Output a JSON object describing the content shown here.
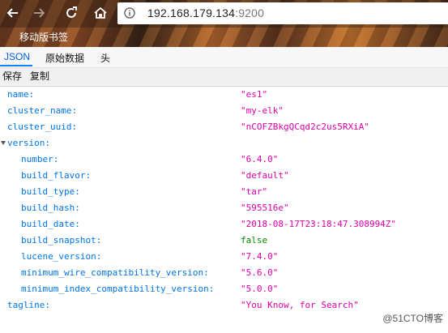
{
  "browser": {
    "url_host": "192.168.179.134",
    "url_port": ":9200",
    "bookmarks_label": "移动版书签"
  },
  "tabs": [
    {
      "label": "JSON",
      "active": true
    },
    {
      "label": "原始数据",
      "active": false
    },
    {
      "label": "头",
      "active": false
    }
  ],
  "toolbar": {
    "save_label": "保存",
    "copy_label": "复制"
  },
  "json_rows": [
    {
      "key": "name:",
      "value": "\"es1\"",
      "type": "string"
    },
    {
      "key": "cluster_name:",
      "value": "\"my-elk\"",
      "type": "string"
    },
    {
      "key": "cluster_uuid:",
      "value": "\"nCOFZBkgQCqd2c2us5RXiA\"",
      "type": "string"
    },
    {
      "key": "version:",
      "value": "",
      "type": "object"
    },
    {
      "key": "number:",
      "value": "\"6.4.0\"",
      "type": "string"
    },
    {
      "key": "build_flavor:",
      "value": "\"default\"",
      "type": "string"
    },
    {
      "key": "build_type:",
      "value": "\"tar\"",
      "type": "string"
    },
    {
      "key": "build_hash:",
      "value": "\"595516e\"",
      "type": "string"
    },
    {
      "key": "build_date:",
      "value": "\"2018-08-17T23:18:47.308994Z\"",
      "type": "string"
    },
    {
      "key": "build_snapshot:",
      "value": "false",
      "type": "bool"
    },
    {
      "key": "lucene_version:",
      "value": "\"7.4.0\"",
      "type": "string"
    },
    {
      "key": "minimum_wire_compatibility_version:",
      "value": "\"5.6.0\"",
      "type": "string"
    },
    {
      "key": "minimum_index_compatibility_version:",
      "value": "\"5.0.0\"",
      "type": "string"
    },
    {
      "key": "tagline:",
      "value": "\"You Know, for Search\"",
      "type": "string"
    }
  ],
  "watermark": "@51CTO博客"
}
